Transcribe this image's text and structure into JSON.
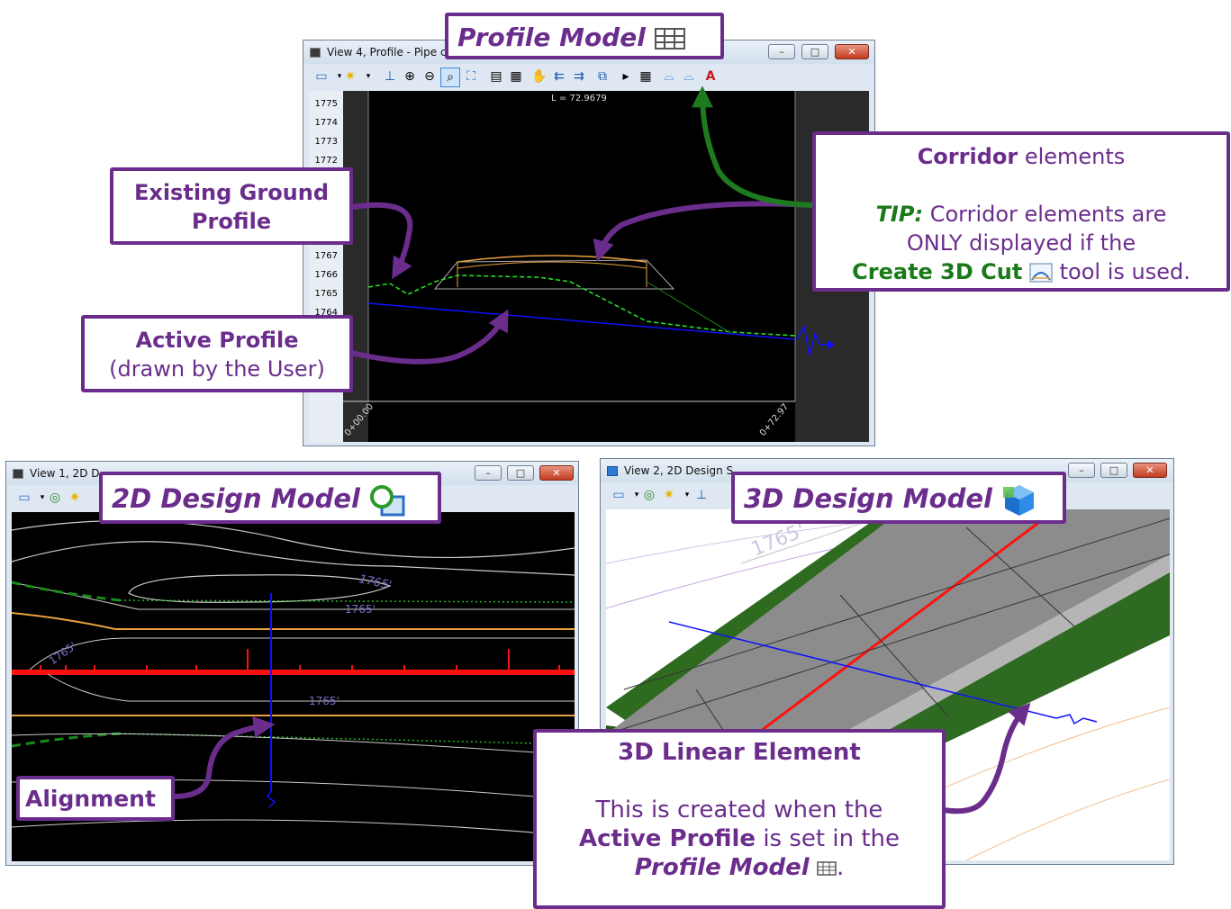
{
  "profile_window": {
    "title": "View 4, Profile - Pipe c",
    "length_label": "L = 72.9679",
    "y_ticks": [
      "1775",
      "1774",
      "1773",
      "1772",
      "1767",
      "1766",
      "1765",
      "1764"
    ],
    "station_start": "0+00.00",
    "station_end": "0+72.97",
    "label": "Profile Model"
  },
  "design2d_window": {
    "title": "View 1, 2D D",
    "label": "2D Design Model",
    "contours": [
      "1765'",
      "1765'",
      "1765'",
      "1765'"
    ]
  },
  "design3d_window": {
    "title": "View 2, 2D Design S",
    "label": "3D Design Model",
    "contour": "1765'"
  },
  "window_buttons": {
    "minimize": "–",
    "maximize": "□",
    "close": "✕"
  },
  "callouts": {
    "existing_ground": {
      "line1": "Existing Ground",
      "line2": "Profile"
    },
    "active_profile": {
      "line1": "Active Profile",
      "line2": "(drawn by the User)"
    },
    "corridor": {
      "title_bold": "Corridor",
      "title_rest": " elements",
      "tip_label": "TIP:",
      "tip_text": " Corridor elements are",
      "tip_line2": "ONLY displayed if the",
      "tip_bold": "Create 3D Cut",
      "tip_end": " tool is used."
    },
    "alignment": {
      "text": "Alignment"
    },
    "linear_element": {
      "title": "3D Linear Element",
      "line1": "This is created when the",
      "line2_bold": "Active Profile",
      "line2_rest": " is set in the",
      "line3_bold": "Profile Model",
      "line3_end": "."
    }
  },
  "colors": {
    "callout_border": "#6b2d8c",
    "arrow_purple": "#6b2d8c",
    "arrow_green": "#1e7a1e",
    "viewport_bg": "#000000",
    "active_profile": "#1010ff",
    "existing_ground": "#22dd22",
    "corridor": "#e8a040",
    "alignment": "#ff1010"
  },
  "icons": [
    "grid-icon",
    "shape-icon",
    "cube-icon",
    "cut-icon"
  ]
}
